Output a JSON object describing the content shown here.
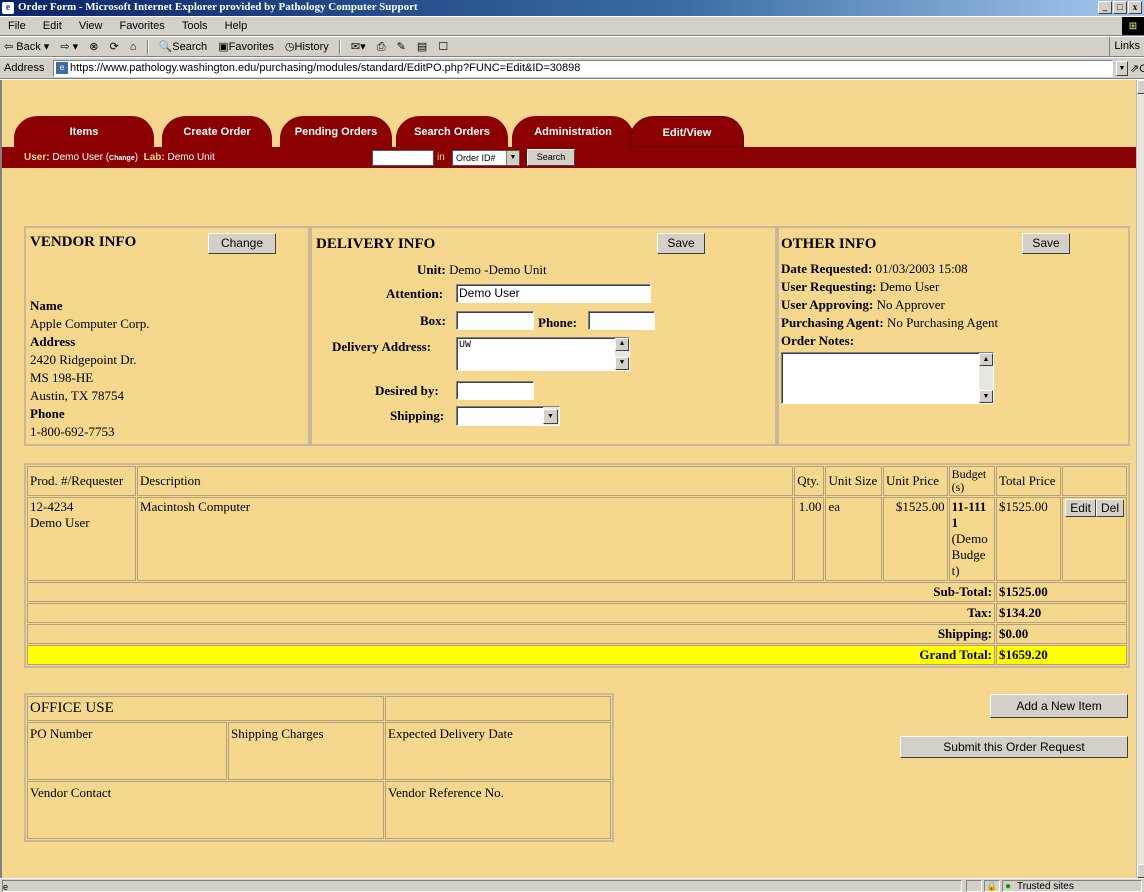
{
  "browser": {
    "title": "Order Form - Microsoft Internet Explorer provided by Pathology Computer Support",
    "menu": [
      "File",
      "Edit",
      "View",
      "Favorites",
      "Tools",
      "Help"
    ],
    "toolbar": {
      "back": "⇦ Back ▾",
      "forward": "⇨ ▾",
      "search": "Search",
      "favorites": "Favorites",
      "history": "History",
      "links": "Links"
    },
    "address_label": "Address",
    "url": "https://www.pathology.washington.edu/purchasing/modules/standard/EditPO.php?FUNC=Edit&ID=30898",
    "go": "Go",
    "status_zone": "Trusted sites"
  },
  "nav": {
    "tabs": [
      "Items",
      "Create Order",
      "Pending Orders",
      "Search Orders",
      "Administration",
      "Edit/View"
    ],
    "user_label": "User:",
    "user_name": "Demo User",
    "change_link": "Change",
    "lab_label": "Lab:",
    "lab_name": "Demo Unit",
    "search_in": "in",
    "search_field": "Order ID#",
    "search_button": "Search"
  },
  "vendor": {
    "heading": "VENDOR INFO",
    "change_button": "Change",
    "name_label": "Name",
    "name": "Apple Computer Corp.",
    "address_label": "Address",
    "address_lines": [
      "2420 Ridgepoint Dr.",
      "MS 198-HE",
      "Austin, TX 78754"
    ],
    "phone_label": "Phone",
    "phone": "1-800-692-7753"
  },
  "delivery": {
    "heading": "DELIVERY INFO",
    "save_button": "Save",
    "unit_label": "Unit:",
    "unit_value": "Demo -Demo Unit",
    "attention_label": "Attention:",
    "attention_value": "Demo User",
    "box_label": "Box:",
    "phone_label": "Phone:",
    "address_label": "Delivery Address:",
    "address_value": "UW",
    "desired_label": "Desired by:",
    "shipping_label": "Shipping:"
  },
  "other": {
    "heading": "OTHER INFO",
    "save_button": "Save",
    "date_label": "Date Requested:",
    "date_value": "01/03/2003 15:08",
    "req_label": "User Requesting:",
    "req_value": "Demo User",
    "appr_label": "User Approving:",
    "appr_value": "No Approver",
    "agent_label": "Purchasing Agent:",
    "agent_value": "No Purchasing Agent",
    "notes_label": "Order Notes:"
  },
  "items": {
    "headers": [
      "Prod. #/Requester",
      "Description",
      "Qty.",
      "Unit Size",
      "Unit Price",
      "Budget (s)",
      "Total Price"
    ],
    "rows": [
      {
        "prod": "12-4234",
        "requester": "Demo User",
        "description": "Macintosh Computer",
        "qty": "1.00",
        "unit_size": "ea",
        "unit_price": "$1525.00",
        "budget": "11-1111",
        "budget_name": "(Demo Budget)",
        "total": "$1525.00",
        "edit": "Edit",
        "del": "Del"
      }
    ],
    "subtotal_label": "Sub-Total:",
    "subtotal": "$1525.00",
    "tax_label": "Tax:",
    "tax": "$134.20",
    "shipping_label": "Shipping:",
    "shipping": "$0.00",
    "grand_label": "Grand Total:",
    "grand": "$1659.20"
  },
  "office": {
    "heading": "OFFICE USE",
    "po": "PO Number",
    "ship_charges": "Shipping Charges",
    "expected": "Expected Delivery Date",
    "contact": "Vendor Contact",
    "reference": "Vendor Reference No."
  },
  "actions": {
    "add_item": "Add a New Item",
    "submit": "Submit this Order Request"
  }
}
